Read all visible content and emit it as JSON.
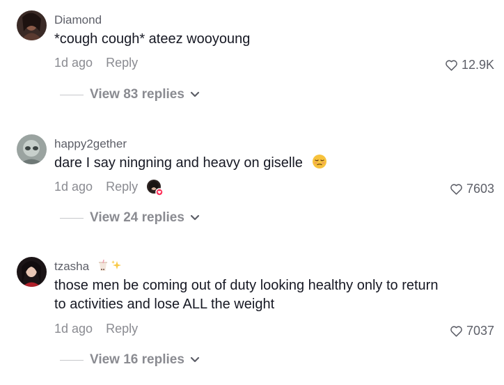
{
  "comments": [
    {
      "username": "Diamond",
      "text": "*cough cough* ateez wooyoung",
      "time": "1d ago",
      "reply_label": "Reply",
      "likes": "12.9K",
      "view_replies": "View 83 replies"
    },
    {
      "username": "happy2gether",
      "text": "dare I say ningning and heavy on giselle",
      "time": "1d ago",
      "reply_label": "Reply",
      "likes": "7603",
      "view_replies": "View 24 replies"
    },
    {
      "username": "tzasha",
      "text": "those men be coming out of duty looking healthy only to return to activities and lose ALL the weight",
      "time": "1d ago",
      "reply_label": "Reply",
      "likes": "7037",
      "view_replies": "View 16 replies"
    }
  ],
  "icons": {
    "like": "heart-outline-icon",
    "expand": "chevron-down-icon",
    "emoji": "pensive-face-emoji",
    "username_badges": [
      "bubble-tea-emoji",
      "sparkles-emoji"
    ]
  }
}
